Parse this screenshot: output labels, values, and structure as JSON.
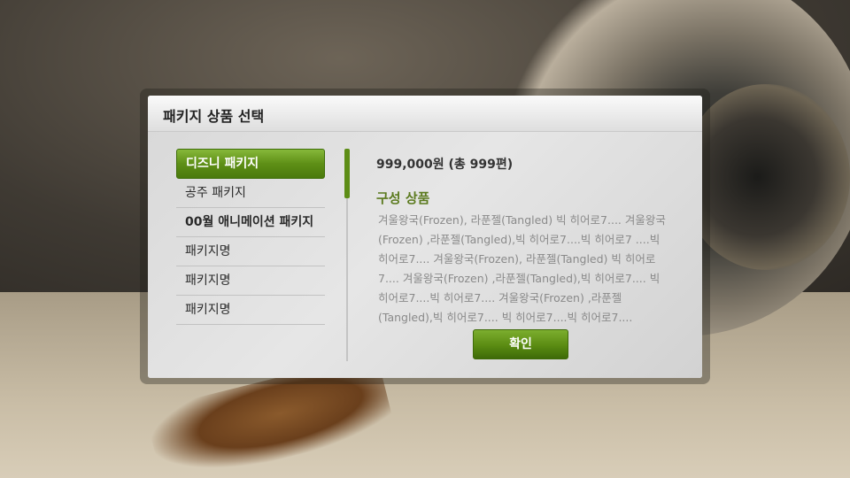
{
  "dialog": {
    "title": "패키지 상품 선택"
  },
  "menu": {
    "items": [
      {
        "label": "디즈니 패키지"
      },
      {
        "label": "공주 패키지"
      },
      {
        "label": "00월 애니메이션 패키지"
      },
      {
        "label": "패키지명"
      },
      {
        "label": "패키지명"
      },
      {
        "label": "패키지명"
      }
    ]
  },
  "detail": {
    "price": "999,000원 (총 999편)",
    "section_title": "구성 상품",
    "description": "겨울왕국(Frozen), 라푼젤(Tangled) 빅 히어로7.... 겨울왕국(Frozen) ,라푼젤(Tangled),빅 히어로7....빅 히어로7 ....빅 히어로7.... 겨울왕국(Frozen), 라푼젤(Tangled) 빅 히어로7.... 겨울왕국(Frozen) ,라푼젤(Tangled),빅 히어로7.... 빅 히어로7....빅 히어로7.... 겨울왕국(Frozen) ,라푼젤(Tangled),빅 히어로7.... 빅 히어로7....빅 히어로7...."
  },
  "buttons": {
    "confirm": "확인"
  },
  "colors": {
    "accent_green": "#5e8f16",
    "section_title": "#5b7a1e"
  }
}
